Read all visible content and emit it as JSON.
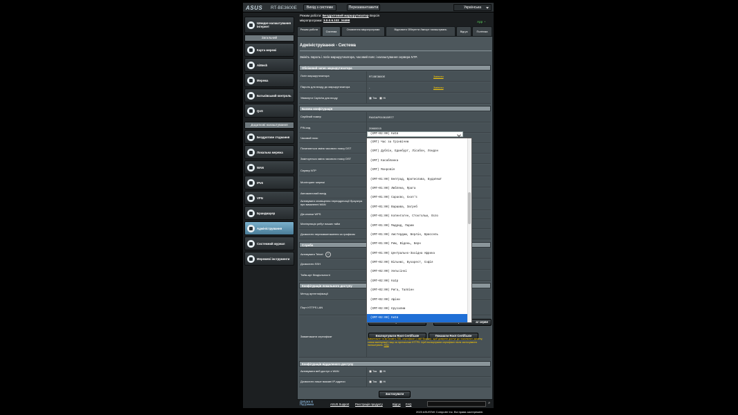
{
  "topbar": {
    "logo": "ASUS",
    "model": "RT-BE3600E",
    "logout": "Вихід з системи",
    "reboot": "Перезавантажити",
    "language": "Українська"
  },
  "header": {
    "mode_label": "Режим роботи:",
    "mode_value": "Бездротовий маршрутизатор",
    "version_label": "Версія",
    "firmware_label": "мікропрограми:",
    "firmware_value": "3.0.0.6.102_34498",
    "app_label": "App"
  },
  "tabs": [
    {
      "label": "Режим роботи"
    },
    {
      "label": "Система"
    },
    {
      "label": "Оновлення мікропрограми"
    },
    {
      "label": "Відновити /Зберегти /Імпорт налаштувань"
    },
    {
      "label": "Відгук"
    },
    {
      "label": "Політика"
    }
  ],
  "sidebar": {
    "quick": "Швидке налаштування Інтернет",
    "general_header": "Загальний",
    "general": [
      {
        "label": "Карта мережі"
      },
      {
        "label": "AiMesh"
      },
      {
        "label": "Мережа"
      },
      {
        "label": "Батьківський контроль"
      },
      {
        "label": "QoS"
      }
    ],
    "advanced_header": "Додаткові налаштування",
    "advanced": [
      {
        "label": "Бездротове з'єднання"
      },
      {
        "label": "Локальна мережа"
      },
      {
        "label": "WAN"
      },
      {
        "label": "IPv6"
      },
      {
        "label": "VPN"
      },
      {
        "label": "Брандмауер"
      },
      {
        "label": "Адміністрування"
      },
      {
        "label": "Системний журнал"
      },
      {
        "label": "Мережеві інструменти"
      }
    ]
  },
  "page": {
    "title": "Адміністрування - Система",
    "description": "Змініть пароль і логін маршрутизатора, часовий пояс і налаштування сервера NTP."
  },
  "sections": {
    "account": "Обліковий запис маршрутизатора",
    "basic": "Базова конфігурація",
    "service": "Служба",
    "local_access": "Конфігурація локального доступу",
    "remote_access": "Конфігурація віддаленого доступу"
  },
  "rows": {
    "login_label": "Логін маршрутизатора",
    "login_value": "RT-BE3600E",
    "password_label": "Пароль для входу до маршрутизатора",
    "password_value": "-",
    "change": "Змінити",
    "captcha_label": "Увімкнути Captcha для входу",
    "yes": "Так",
    "no": "Ні",
    "serial_label": "Серійний номер",
    "serial_value": "RAIGAP010615R77",
    "pin_label": "PIN-код",
    "pin_value": "20660015",
    "timezone_label": "Часовий пояс",
    "timezone_value": "(GMT+02:00) Київ",
    "dst_start": "Починається зміна часового поясу DST",
    "dst_end": "Закінчується зміна часового поясу DST",
    "ntp": "Сервер NTP",
    "net_monitor": "Моніторинг мережі",
    "auto_logout": "Автоматичний вихід",
    "redirect": "Активувати сповіщення переадресації браузера при вимкненні WAN",
    "wps_button": "Дія кнопки WPS",
    "reboot_schedule": "Маніпуляція ребут ваших тайм",
    "reboot_toggle": "Дозволити перезавантаження за графіком",
    "telnet": "Активувати Telnet",
    "ssh": "Дозволити SSH",
    "idle_timeout": "Тайм-аут бездіяльності",
    "auth_method": "Метод аутентифікації",
    "https_port": "Порт HTTPS LAN",
    "cert_label": "Завантажити сертифікат",
    "cert_partial_1": "ра",
    "cert_partial_2": "ра",
    "cert_partial_right": "аг серве",
    "export_root": "Експортувати Root Certificate",
    "show_root": "Показати Root Certificate",
    "cert_note": "Завантажте та встановіть SSL-сертифікат у свій браузер, щоб довірити доступ до локального домену, схеми маніпуляції тощо за протоколом HTTPS. Щоб експортувати сертифікат після застосування налаштувань.",
    "cert_note_link": "FAQ",
    "remote_wan": "Активувати веб-доступ з WAN",
    "remote_ip": "Дозволити лише вказані IP-адреси",
    "apply": "Застосувати"
  },
  "timezone_options": [
    "(GMT) Час за Грінвічем",
    "(GMT) Дублін, Единбург, Лісабон, Лондон",
    "(GMT) Касабланка",
    "(GMT) Монровія",
    "(GMT+01:00) Белград, Братислава, Будапешт",
    "(GMT+01:00) Любляна, Прага",
    "(GMT+01:00) Сараєво, Скоп'є",
    "(GMT+01:00) Варшава, Загреб",
    "(GMT+01:00) Копенгаген, Стокгольм, Осло",
    "(GMT+01:00) Мадрид, Париж",
    "(GMT+01:00) Амстердам, Берлін, Брюссель",
    "(GMT+01:00) Рим, Відень, Берн",
    "(GMT+01:00) Центрально-Західна Африка",
    "(GMT+02:00) Вільнюс, Бухарест, Софія",
    "(GMT+02:00) Хельсінкі",
    "(GMT+02:00) Каїр",
    "(GMT+02:00) Рига, Таллінн",
    "(GMT+02:00) Афіни",
    "(GMT+02:00) Єрусалим",
    "(GMT+02:00) Київ"
  ],
  "timezone_selected_index": 19,
  "footer": {
    "help": "Довідка & Підтримка",
    "support": "ASUS Support",
    "register": "Реєстрація продукту",
    "feedback": "Відгук",
    "faq": "FAQ"
  },
  "copyright": "2023 ASUSTeK Computer Inc. Всі права застережені.",
  "colors": {
    "accent": "#1f6fd6",
    "link": "#ffcc00",
    "section_header": "#8b969b",
    "content_bg": "#4d575c"
  }
}
